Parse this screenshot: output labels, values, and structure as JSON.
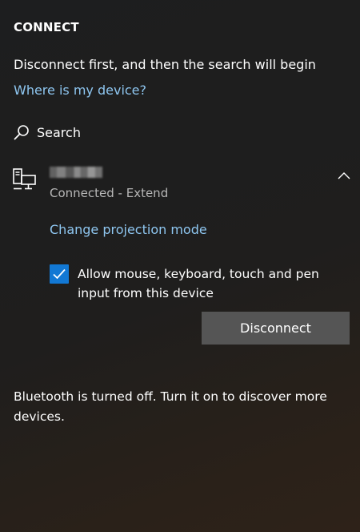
{
  "panel": {
    "title": "CONNECT",
    "info": "Disconnect first, and then the search will begin",
    "help_link": "Where is my device?",
    "search_label": "Search"
  },
  "device": {
    "icon": "display-device-icon",
    "status": "Connected - Extend",
    "projection_link": "Change projection mode",
    "allow_input_checked": true,
    "allow_input_line1": "Allow mouse, keyboard, touch and pen",
    "allow_input_line2": "input from this device",
    "disconnect_label": "Disconnect"
  },
  "bluetooth": {
    "line1": "Bluetooth is turned off. Turn it on to discover more",
    "line2": "devices."
  },
  "colors": {
    "link": "#8ec6f0",
    "accent": "#1278d4",
    "button": "#555555",
    "status": "#b7b7b7"
  }
}
